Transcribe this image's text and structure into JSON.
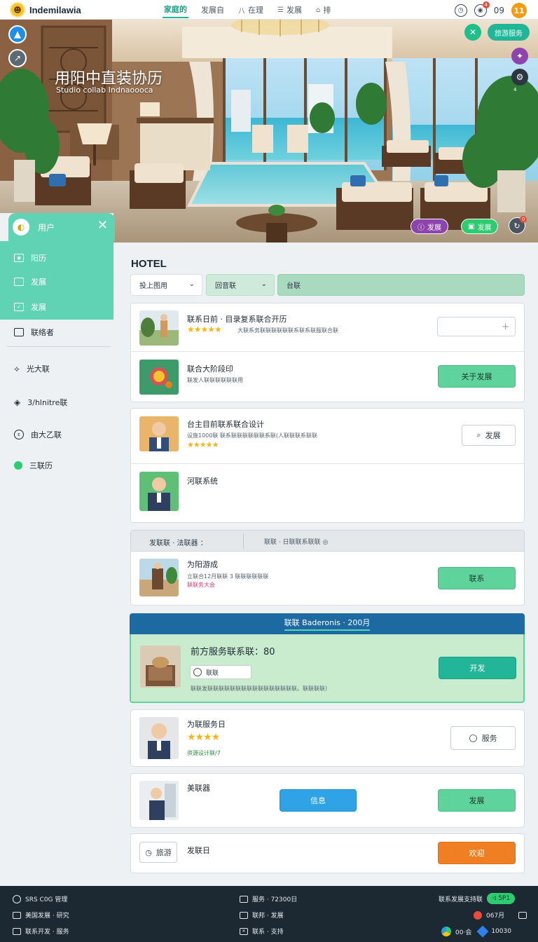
{
  "topbar": {
    "brand": "Indemilawia",
    "nav": [
      {
        "label": "家庭的",
        "icon": ""
      },
      {
        "label": "发展自",
        "icon": ""
      },
      {
        "label": "在理",
        "icon": "八"
      },
      {
        "label": "发展",
        "icon": "☰"
      },
      {
        "label": "排",
        "icon": "⌂"
      }
    ],
    "right_count": "09",
    "notif_count": "4",
    "orange_badge": "11"
  },
  "hero": {
    "title": "用阳中直装协历",
    "subtitle": "Studio collab Indnaoooca",
    "top_pill": "旅游服务",
    "side_label": "4",
    "pill_purple": "发展",
    "pill_green": "发展",
    "pill_gray_badge": "0"
  },
  "sidebar": {
    "title": "用户",
    "items": [
      {
        "label": "阳历"
      },
      {
        "label": "发展"
      },
      {
        "label": "发展"
      },
      {
        "label": "联络者"
      },
      {
        "label": "光大联"
      },
      {
        "label": "3/hlnitre联"
      },
      {
        "label": "由大乙联"
      },
      {
        "label": "三联历"
      }
    ]
  },
  "main": {
    "title": "HOTEL",
    "filters": [
      "投上图用",
      "回音联",
      "台联"
    ],
    "rows": [
      {
        "title": "联系日前 · 目录复系联合开历",
        "sub": "大联系务联联联联联联系联系联服联合联",
        "stars": "★★★★★"
      },
      {
        "title": "联合大阶段印",
        "sub": "联发人联联联联联联用",
        "button": "关于发展"
      },
      {
        "title": "台主目前联系联合设计",
        "sub": "设施1000联 联系联联联联联联系联(人联联联系联联",
        "stars": "★★★★★",
        "button": "发展"
      },
      {
        "title": "河联系统"
      },
      {
        "title": "为阳游成",
        "sub": "立联合12月联联 3 联联联联联联",
        "sub2": "联联务大会",
        "button": "联系"
      },
      {
        "title": "为联服务日",
        "stars": "★★★★",
        "sub": "资源设计联/7",
        "button": "服务"
      },
      {
        "title": "美联器",
        "button_blue": "信息",
        "button_green": "发展"
      },
      {
        "title": "发联日",
        "button_orange": "欢迎",
        "tag": "旅游"
      }
    ],
    "subhead_left": "发联联 · 法联器 ：",
    "subhead_right": "联联 · 日联联系联联 ◎",
    "featured": {
      "head": "联联 Baderonis · 200月",
      "title": "前方服务联系联：80",
      "tag": "联联",
      "sub": "联联发联联联联联联联联联联联联联联联联。联联联联）",
      "button": "开发"
    }
  },
  "footer": {
    "col1": [
      "SRS C0G 管理",
      "美国发展 · 研究",
      "联系开发 · 服务"
    ],
    "col2": [
      "服务 · 72300日",
      "联邦 · 发展",
      "联系 · 支持"
    ],
    "col3_top": "联系发展支持联",
    "col3_pill": "ଏ 5P1",
    "col3_mid": "067月",
    "col3_bottom_left": "00·会",
    "col3_bottom_right": "10030"
  },
  "colors": {
    "accent": "#23b597",
    "sidebar_green": "#5fd3b3",
    "featured_head": "#1d6aa3",
    "footer": "#1d2932"
  }
}
